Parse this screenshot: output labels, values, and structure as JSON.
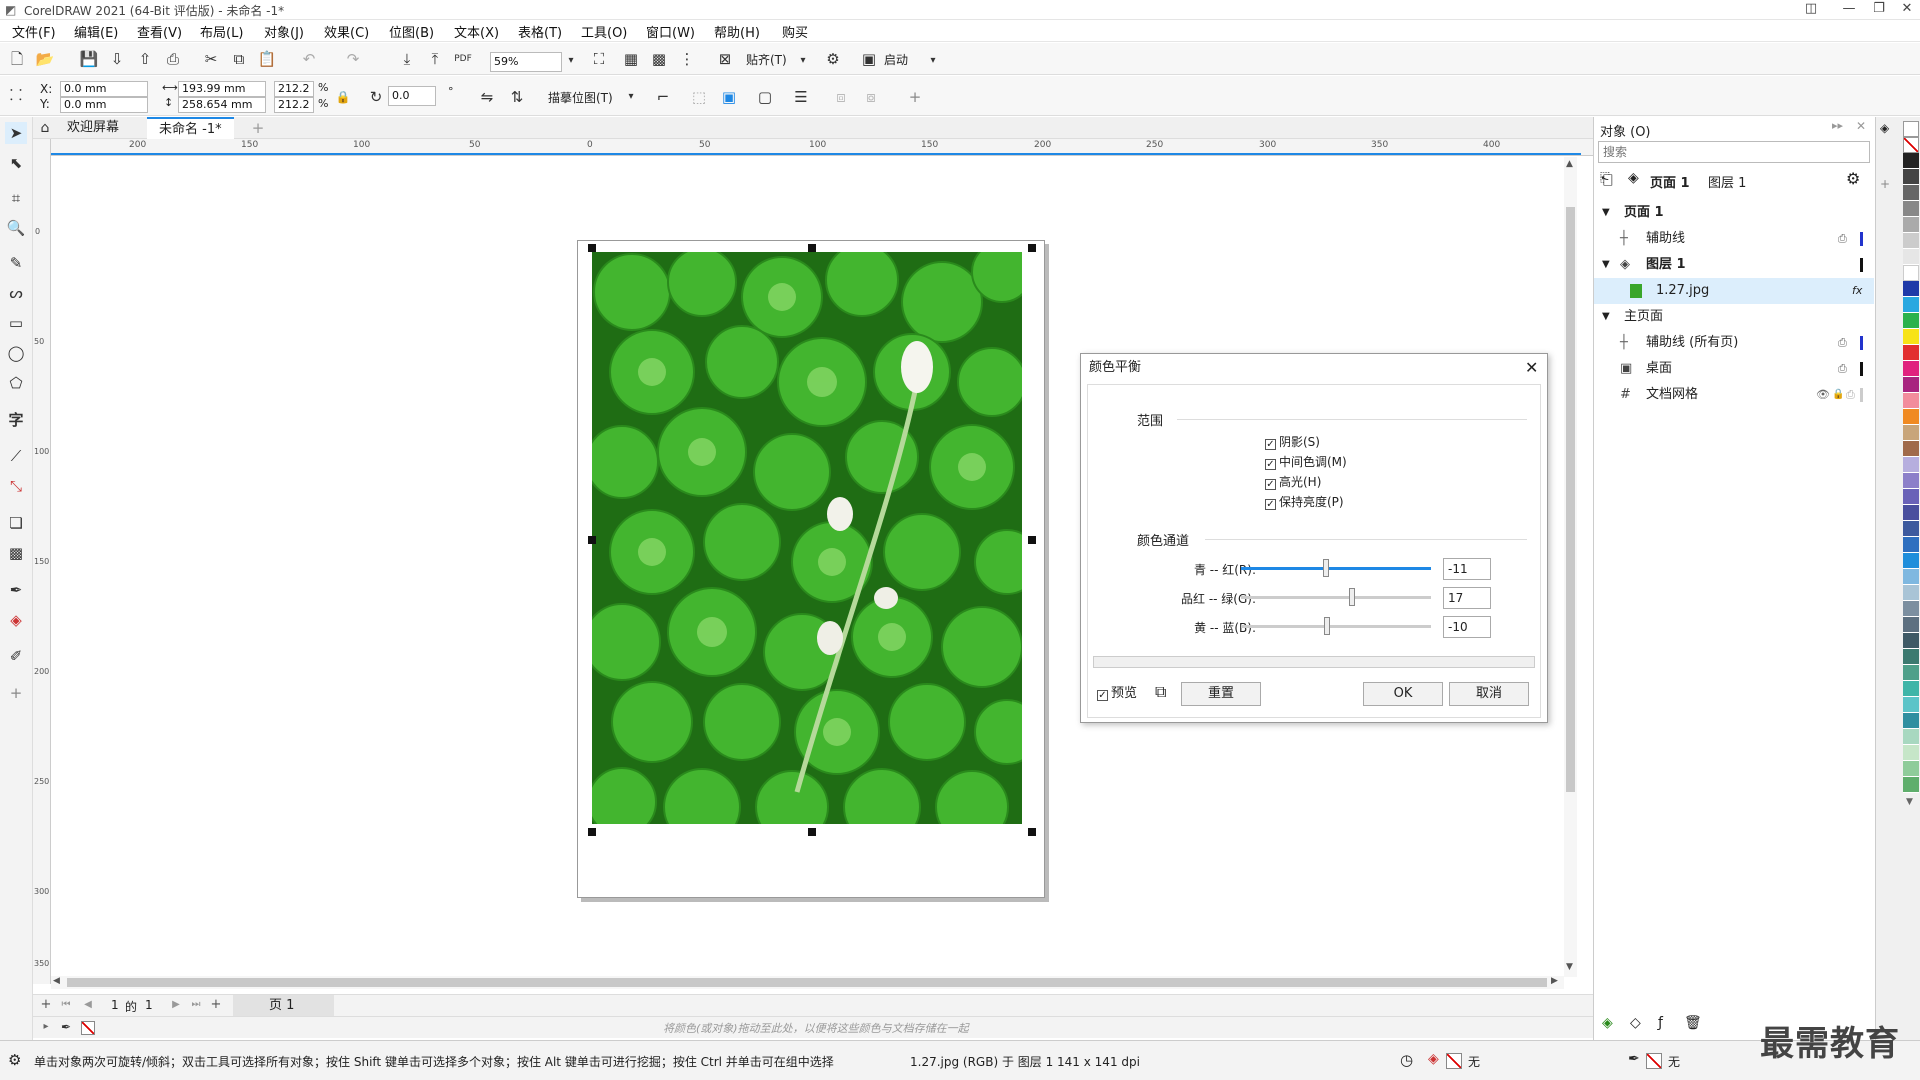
{
  "window": {
    "title": "CorelDRAW 2021 (64-Bit 评估版) - 未命名 -1*"
  },
  "menu": [
    "文件(F)",
    "编辑(E)",
    "查看(V)",
    "布局(L)",
    "对象(J)",
    "效果(C)",
    "位图(B)",
    "文本(X)",
    "表格(T)",
    "工具(O)",
    "窗口(W)",
    "帮助(H)",
    "购买"
  ],
  "toolbar": {
    "zoom": "59%",
    "snap_label": "贴齐(T)",
    "launch_label": "启动"
  },
  "properties": {
    "x_label": "X:",
    "y_label": "Y:",
    "x": "0.0 mm",
    "y": "0.0 mm",
    "width": "193.99 mm",
    "height": "258.654 mm",
    "scale_w": "212.2",
    "scale_h": "212.2",
    "pct": "%",
    "rotation": "0.0",
    "rotation_unit": "°",
    "trace_label": "描摹位图(T)"
  },
  "tabs": {
    "welcome": "欢迎屏幕",
    "doc": "未命名 -1*"
  },
  "ruler": {
    "ticks": [
      "200",
      "150",
      "100",
      "50",
      "0",
      "50",
      "100",
      "150",
      "200",
      "250",
      "300",
      "350",
      "400"
    ],
    "v_ticks": [
      "0",
      "50",
      "100",
      "150",
      "200",
      "250",
      "300",
      "350"
    ]
  },
  "dialog": {
    "title": "颜色平衡",
    "range_label": "范围",
    "checks": [
      {
        "label": "阴影(S)",
        "checked": true
      },
      {
        "label": "中间色调(M)",
        "checked": true
      },
      {
        "label": "高光(H)",
        "checked": true
      },
      {
        "label": "保持亮度(P)",
        "checked": true
      }
    ],
    "channel_label": "颜色通道",
    "sliders": [
      {
        "label": "青 -- 红(R):",
        "value": "-11",
        "pos": 0.445
      },
      {
        "label": "品红 -- 绿(G):",
        "value": "17",
        "pos": 0.585
      },
      {
        "label": "黄 -- 蓝(B):",
        "value": "-10",
        "pos": 0.45
      }
    ],
    "preview_label": "预览",
    "reset_label": "重置",
    "ok_label": "OK",
    "cancel_label": "取消"
  },
  "objects_panel": {
    "title": "对象 (O)",
    "search_placeholder": "搜索",
    "page_label": "页面 1",
    "layer_label": "图层 1",
    "rows": [
      {
        "label": "页面 1",
        "bold": true
      },
      {
        "label": "辅助线"
      },
      {
        "label": "图层 1",
        "bold": true
      },
      {
        "label": "1.27.jpg"
      },
      {
        "label": "主页面"
      },
      {
        "label": "辅助线 (所有页)"
      },
      {
        "label": "桌面"
      },
      {
        "label": "文档网格"
      }
    ]
  },
  "pagenav": {
    "current": "1",
    "of": "的",
    "total": "1",
    "page_tab": "页 1"
  },
  "palette_hint": "将颜色(或对象)拖动至此处，以便将这些颜色与文档存储在一起",
  "status": {
    "hint": "单击对象两次可旋转/倾斜；双击工具可选择所有对象；按住 Shift 键单击可选择多个对象；按住 Alt 键单击可进行挖掘；按住 Ctrl 并单击可在组中选择",
    "info": "1.27.jpg (RGB) 于 图层 1 141 x 141 dpi",
    "fill": "无",
    "outline": "无"
  },
  "watermark": "最需教育",
  "colors": {
    "accent": "#1e88e5",
    "selection": "#dceefc",
    "leaf": "#3aa62a"
  }
}
